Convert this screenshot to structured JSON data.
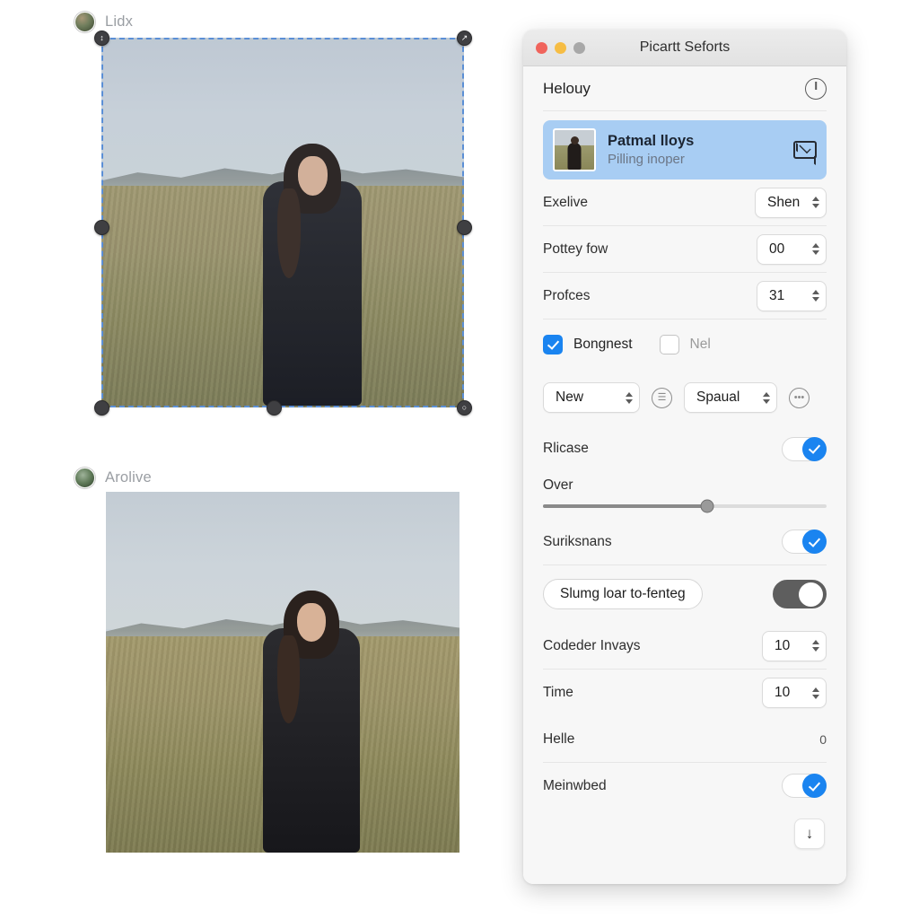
{
  "canvas": {
    "items": [
      {
        "label": "Lidx",
        "avatar_icon": "user-avatar-icon"
      },
      {
        "label": "Arolive",
        "avatar_icon": "user-avatar-icon"
      }
    ],
    "selection": {
      "handle_icons": [
        "resize-handle-tl",
        "resize-handle-tr",
        "resize-handle-left",
        "resize-handle-right",
        "resize-handle-bottom",
        "resize-handle-bl",
        "resize-handle-br"
      ]
    }
  },
  "panel": {
    "title": "Picartt Seforts",
    "traffic_lights": {
      "close": "close-button",
      "minimize": "minimize-button",
      "zoom": "zoom-button"
    },
    "section": {
      "title": "Helouy",
      "action_icon": "power-icon"
    },
    "contact": {
      "name": "Patmal lloys",
      "subtitle": "Pilling inoper",
      "mail_icon": "envelope-icon",
      "thumbnail": "contact-thumbnail"
    },
    "rows": [
      {
        "label": "Exelive",
        "value": "Shen",
        "control": "stepper"
      },
      {
        "label": "Pottey fow",
        "value": "00",
        "control": "stepper"
      },
      {
        "label": "Profces",
        "value": "31",
        "control": "stepper"
      }
    ],
    "checkboxes": [
      {
        "label": "Bongnest",
        "checked": true
      },
      {
        "label": "Nel",
        "checked": false
      }
    ],
    "selects": [
      {
        "value": "New",
        "icon": "filter-circle-icon"
      },
      {
        "value": "Spaual",
        "icon": "more-circle-icon"
      }
    ],
    "toggle_rows": [
      {
        "label": "Rlicase",
        "on": true
      },
      {
        "label": "Suriksnans",
        "on": true
      },
      {
        "label": "Meinwbed",
        "on": true
      }
    ],
    "slider": {
      "label": "Over",
      "percent": 58
    },
    "pill": {
      "label": "Slumg loar to-fenteg",
      "toggle_on": false
    },
    "bottom_rows": [
      {
        "label": "Codeder Invays",
        "value": "10",
        "control": "stepper"
      },
      {
        "label": "Time",
        "value": "10",
        "control": "stepper"
      },
      {
        "label": "Helle",
        "value": "0",
        "control": "text"
      }
    ],
    "footer": {
      "download_icon": "download-icon"
    }
  },
  "colors": {
    "accent": "#1a84f0",
    "selection_border": "#5b8fd6",
    "contact_bg": "#a8cdf3",
    "panel_bg": "#f7f7f7"
  }
}
